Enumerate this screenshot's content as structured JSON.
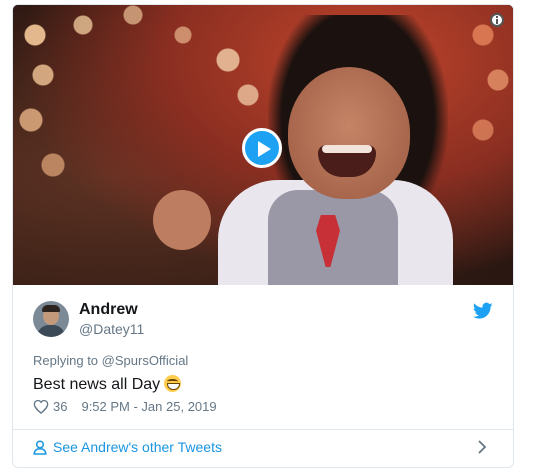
{
  "media": {
    "play_icon": "play-icon",
    "info_icon": "info-icon"
  },
  "tweet": {
    "name": "Andrew",
    "handle": "@Datey11",
    "reply_prefix": "Replying to ",
    "reply_to": "@SpursOfficial",
    "text": "Best news all Day",
    "emoji": "grinning-face-emoji",
    "likes": "36",
    "timestamp": "9:52 PM - Jan 25, 2019"
  },
  "footer": {
    "see_more_label": "See Andrew's other Tweets"
  },
  "colors": {
    "accent": "#1da1f2",
    "link": "#1b95e0",
    "muted": "#657786",
    "text": "#14171a",
    "border": "#e1e8ed"
  }
}
